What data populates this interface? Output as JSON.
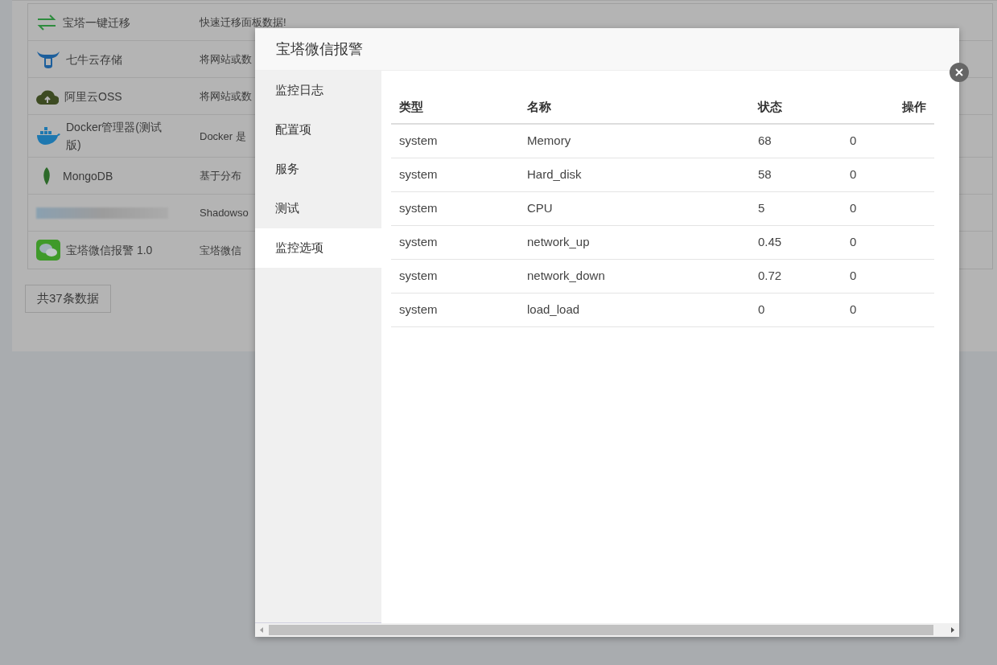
{
  "background_page": {
    "plugins": [
      {
        "kind": "arrows",
        "name": "宝塔一键迁移",
        "description": "快速迁移面板数据!"
      },
      {
        "kind": "bull",
        "name": "七牛云存储",
        "description": "将网站或数"
      },
      {
        "kind": "cloud",
        "name": "阿里云OSS",
        "description": "将网站或数"
      },
      {
        "kind": "whale",
        "name": "Docker管理器(测试版)",
        "description": "Docker 是"
      },
      {
        "kind": "leaf",
        "name": "MongoDB",
        "description": "基于分布"
      },
      {
        "kind": "redacted",
        "description": "Shadowso"
      },
      {
        "kind": "chat",
        "name": "宝塔微信报警 1.0",
        "description": "宝塔微信"
      }
    ],
    "total": "共37条数据"
  },
  "dialog": {
    "title": "宝塔微信报警",
    "sidebar": [
      {
        "label": "监控日志",
        "selected": false
      },
      {
        "label": "配置项",
        "selected": false
      },
      {
        "label": "服务",
        "selected": false
      },
      {
        "label": "测试",
        "selected": false
      },
      {
        "label": "监控选项",
        "selected": true
      }
    ],
    "table": {
      "columns": [
        "类型",
        "名称",
        "状态",
        "操作"
      ],
      "rows": [
        [
          "system",
          "Memory",
          "68",
          "0"
        ],
        [
          "system",
          "Hard_disk",
          "58",
          "0"
        ],
        [
          "system",
          "CPU",
          "5",
          "0"
        ],
        [
          "system",
          "network_up",
          "0.45",
          "0"
        ],
        [
          "system",
          "network_down",
          "0.72",
          "0"
        ],
        [
          "system",
          "load_load",
          "0",
          "0"
        ]
      ]
    }
  }
}
